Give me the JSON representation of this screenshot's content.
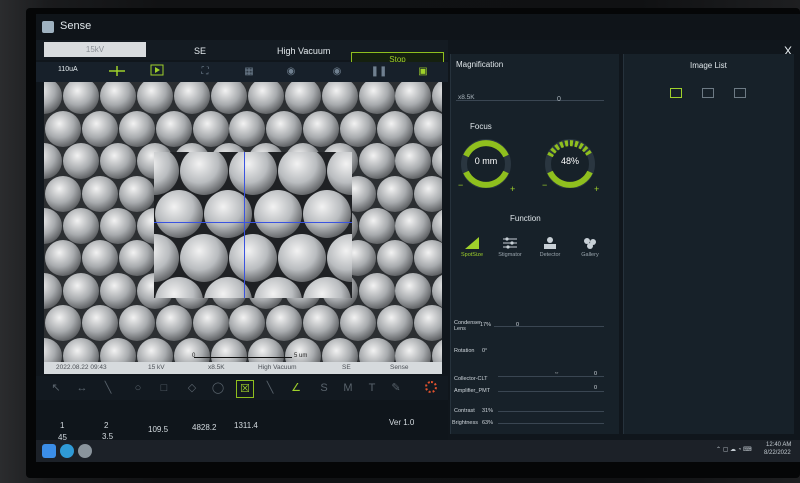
{
  "window": {
    "title": "Sense",
    "close_label": "X"
  },
  "status": {
    "beam_voltage": "15kV",
    "detector": "SE",
    "vacuum": "High Vacuum",
    "stop_label": "Stop",
    "current": "110uA"
  },
  "toolbar": {
    "icons": [
      "crosshair-icon",
      "play-icon",
      "fullscreen-icon",
      "grid-icon",
      "record-icon",
      "snapshot-icon",
      "pause-icon",
      "save-icon"
    ]
  },
  "infobar": {
    "date": "2022.08.22 09:43",
    "kv": "15 kV",
    "mag": "x8.5K",
    "vacuum": "High Vacuum",
    "detector": "SE",
    "brand": "Sense"
  },
  "scalebar": {
    "zero": "0",
    "length": "5 um"
  },
  "bottom_tools": [
    "undo-icon",
    "line-icon",
    "pen-icon",
    "circle-icon",
    "rect-icon",
    "polygon-icon",
    "select-icon",
    "angle-icon",
    "curve-icon",
    "sm-icon",
    "text-icon",
    "marker-icon",
    "settings-icon"
  ],
  "stats": {
    "row1": [
      "1",
      "2",
      "109.5",
      "4828.2",
      "1311.4"
    ],
    "row2": [
      "45",
      "3.5"
    ],
    "version": "Ver 1.0"
  },
  "magnification": {
    "heading": "Magnification",
    "value": "x8.5K",
    "slider_zero": "0"
  },
  "focus": {
    "heading": "Focus",
    "focus_value": "0 mm",
    "contrast_value": "48%",
    "contrast_level": 0.48
  },
  "function": {
    "heading": "Function",
    "buttons": [
      {
        "label": "SpotSize",
        "icon": "spotsize-icon",
        "active": true
      },
      {
        "label": "Stigmator",
        "icon": "stigmator-icon",
        "active": false
      },
      {
        "label": "Detector",
        "icon": "detector-icon",
        "active": false
      },
      {
        "label": "Gallery",
        "icon": "gallery-icon",
        "active": false
      }
    ]
  },
  "params": {
    "condenser_label": "Condenser Lens",
    "condenser_value": "17%",
    "condenser_zero": "0",
    "rotation_label": "Rotation",
    "rotation_value": "0°",
    "collector_label": "Collector-CLT",
    "collector_value": "0",
    "amplifier_label": "Amplifier_PMT",
    "amplifier_value": "0",
    "contrast_label": "Contrast",
    "contrast_value": "31%",
    "brightness_label": "Brightness",
    "brightness_value": "63%"
  },
  "image_list": {
    "heading": "Image List",
    "icons": [
      "image-icon",
      "folder-icon",
      "grid-view-icon"
    ]
  },
  "taskbar": {
    "clock": "12:40 AM",
    "date": "8/22/2022"
  },
  "colors": {
    "accent": "#9fd12b",
    "panel": "#172129",
    "crosshair": "#3a53e0"
  }
}
